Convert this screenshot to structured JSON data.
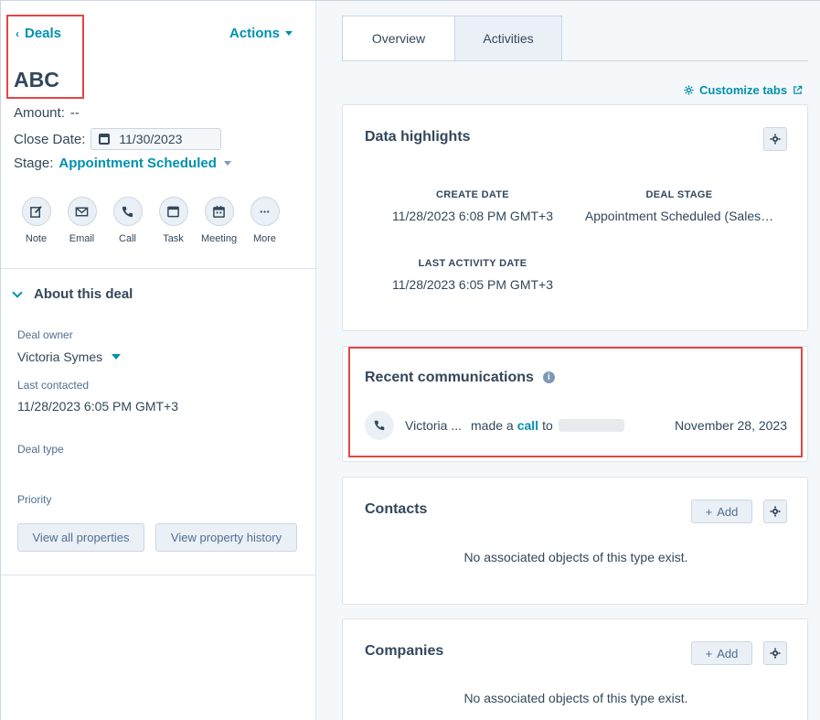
{
  "header": {
    "back_label": "Deals",
    "actions_label": "Actions",
    "record_title": "ABC"
  },
  "fields": {
    "amount_label": "Amount:",
    "amount_value": "--",
    "close_date_label": "Close Date:",
    "close_date_value": "11/30/2023",
    "stage_label": "Stage:",
    "stage_value": "Appointment Scheduled"
  },
  "quick_actions": [
    {
      "label": "Note",
      "icon": "note-icon"
    },
    {
      "label": "Email",
      "icon": "email-icon"
    },
    {
      "label": "Call",
      "icon": "call-icon"
    },
    {
      "label": "Task",
      "icon": "task-icon"
    },
    {
      "label": "Meeting",
      "icon": "meeting-icon"
    },
    {
      "label": "More",
      "icon": "more-icon"
    }
  ],
  "about": {
    "title": "About this deal",
    "deal_owner_label": "Deal owner",
    "deal_owner_value": "Victoria Symes",
    "last_contacted_label": "Last contacted",
    "last_contacted_value": "11/28/2023 6:05 PM GMT+3",
    "deal_type_label": "Deal type",
    "priority_label": "Priority",
    "view_all_label": "View all properties",
    "view_history_label": "View property history"
  },
  "tabs": [
    {
      "label": "Overview",
      "active": true
    },
    {
      "label": "Activities",
      "active": false
    }
  ],
  "customize_label": "Customize tabs",
  "highlights": {
    "title": "Data highlights",
    "create_date_label": "CREATE DATE",
    "create_date_value": "11/28/2023 6:08 PM GMT+3",
    "deal_stage_label": "DEAL STAGE",
    "deal_stage_value": "Appointment Scheduled (Sales…",
    "last_activity_label": "LAST ACTIVITY DATE",
    "last_activity_value": "11/28/2023 6:05 PM GMT+3"
  },
  "communications": {
    "title": "Recent communications",
    "actor": "Victoria ...",
    "action_pre": "made a",
    "action_link": "call",
    "action_post": "to",
    "date": "November 28, 2023"
  },
  "contacts": {
    "title": "Contacts",
    "add_label": "Add",
    "empty_text": "No associated objects of this type exist."
  },
  "companies": {
    "title": "Companies",
    "add_label": "Add",
    "empty_text": "No associated objects of this type exist."
  },
  "colors": {
    "accent": "#0091ae",
    "text": "#33475b",
    "highlight_box": "#e34646"
  }
}
